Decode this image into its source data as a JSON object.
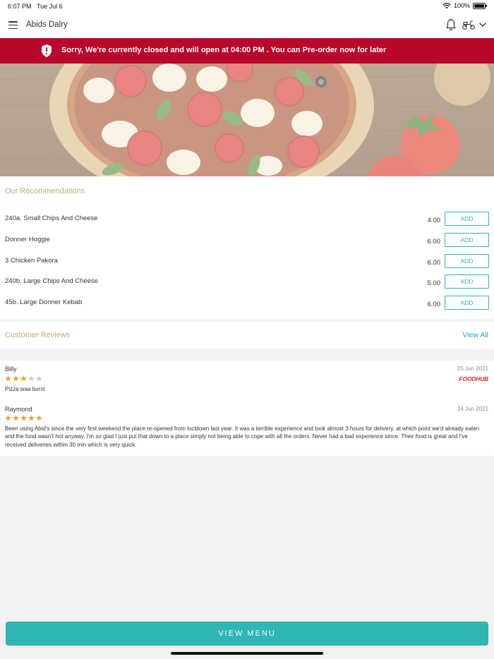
{
  "status_bar": {
    "time": "6:07 PM",
    "date": "Tue Jul 6",
    "battery": "100%"
  },
  "header": {
    "store_name": "Abids Dalry"
  },
  "banner": {
    "message": "Sorry, We're currently closed and will open at 04:00 PM . You can Pre-order now for later",
    "color": "#b8082c"
  },
  "recommendations": {
    "title": "Our Recommendations",
    "items": [
      {
        "name": "240a. Small Chips And Cheese",
        "price": "4.00",
        "button": "ADD"
      },
      {
        "name": "Donner Hoggie",
        "price": "6.00",
        "button": "ADD"
      },
      {
        "name": "3 Chicken Pakora",
        "price": "6.00",
        "button": "ADD"
      },
      {
        "name": "240b. Large Chips And Cheese",
        "price": "5.00",
        "button": "ADD"
      },
      {
        "name": "45b. Large Donner Kebab",
        "price": "6.00",
        "button": "ADD"
      }
    ]
  },
  "reviews": {
    "title": "Customer Reviews",
    "view_all": "View All",
    "items": [
      {
        "author": "Billy",
        "date": "25 Jun 2021",
        "rating": 3,
        "text": "Pizza waa burnt",
        "source": "FOODHUB"
      },
      {
        "author": "Raymond",
        "date": "24 Jun 2021",
        "rating": 5,
        "text": "Been using Abid's since the very first weekend the place re-opened from locldown last year. It was a terrible experience and took almost 3 hours for delivery, at which point we'd already eaten and the food wasn't hot anyway. I'm so glad I just put that down to a place simply not being able to cope with all the orders. Never had a bad experience since. Their food is great and I've received deliveries within 30 min which is very quick."
      }
    ]
  },
  "footer": {
    "view_menu": "VIEW MENU"
  },
  "colors": {
    "accent": "#2fb5b3",
    "section_title": "#c5a37b",
    "star": "#f0a030",
    "star_empty": "#cfcfcf"
  }
}
